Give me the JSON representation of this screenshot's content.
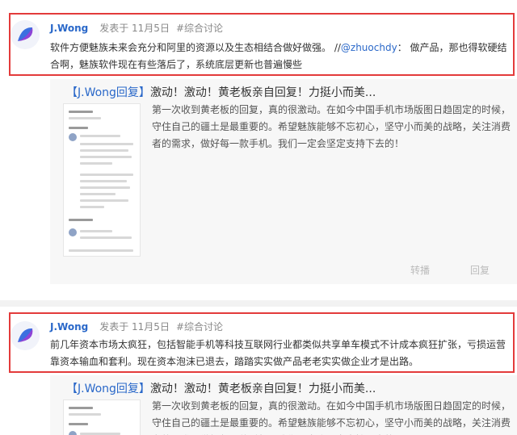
{
  "posts": [
    {
      "author": "J.Wong",
      "posted": "发表于 11月5日",
      "category": "#综合讨论",
      "comment_pre": "软件方便魅族未来会充分和阿里的资源以及生态相结合做好做强。 //",
      "mention": "@zhuochdy",
      "comment_post": "： 做产品，那也得软硬结合啊，魅族软件现在有些落后了，系统底层更新也普遍慢些",
      "quote": {
        "source": "【J.Wong回复】",
        "title": "激动！激动！黄老板亲自回复！力挺小而美...",
        "body": "第一次收到黄老板的回复，真的很激动。在如今中国手机市场版图日趋固定的时候，守住自己的疆土是最重要的。希望魅族能够不忘初心，坚守小而美的战略，关注消费者的需求，做好每一款手机。我们一定会坚定支持下去的！",
        "forward_label": "转播",
        "reply_label": "回复"
      }
    },
    {
      "author": "J.Wong",
      "posted": "发表于 11月5日",
      "category": "#综合讨论",
      "comment": "前几年资本市场太疯狂，包括智能手机等科技互联网行业都类似共享单车模式不计成本疯狂扩张，亏损运营靠资本输血和套利。现在资本泡沫已退去，踏踏实实做产品老老实实做企业才是出路。",
      "quote": {
        "source": "【J.Wong回复】",
        "title": "激动！激动！黄老板亲自回复！力挺小而美...",
        "body": "第一次收到黄老板的回复，真的很激动。在如今中国手机市场版图日趋固定的时候，守住自己的疆土是最重要的。希望魅族能够不忘初心，坚守小而美的战略，关注消费者的需求，做好每一款手机。我们一定会坚定支持下去的！"
      }
    }
  ],
  "colors": {
    "highlight_border": "#e33b3b",
    "link": "#2a68c9"
  }
}
